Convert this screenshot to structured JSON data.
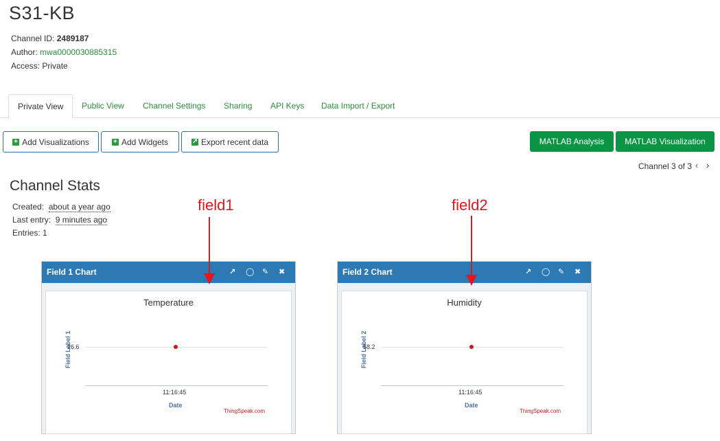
{
  "page": {
    "title": "S31-KB",
    "channel_id_label": "Channel ID:",
    "channel_id": "2489187",
    "author_label": "Author:",
    "author": "mwa0000030885315",
    "access_label": "Access:",
    "access": "Private"
  },
  "tabs": [
    {
      "label": "Private View",
      "active": true
    },
    {
      "label": "Public View"
    },
    {
      "label": "Channel Settings"
    },
    {
      "label": "Sharing"
    },
    {
      "label": "API Keys"
    },
    {
      "label": "Data Import / Export"
    }
  ],
  "toolbar": {
    "add_visualizations": "Add Visualizations",
    "add_widgets": "Add Widgets",
    "export_recent": "Export recent data",
    "matlab_analysis": "MATLAB Analysis",
    "matlab_visualization": "MATLAB Visualization",
    "channel_nav": "Channel 3 of 3",
    "prev_icon": "chevron-left-icon",
    "next_icon": "chevron-right-icon"
  },
  "stats": {
    "heading": "Channel Stats",
    "created_label": "Created:",
    "created": "about a year ago",
    "last_entry_label": "Last entry:",
    "last_entry": "9 minutes ago",
    "entries_label": "Entries:",
    "entries": "1"
  },
  "annotations": {
    "field1": "field1",
    "field2": "field2",
    "color": "#e8141b"
  },
  "charts": [
    {
      "header": "Field 1 Chart",
      "title": "Temperature",
      "ylabel": "Field Label 1",
      "ytick": "26.6",
      "xtick": "11:16:45",
      "xlabel": "Date",
      "credit": "ThingSpeak.com"
    },
    {
      "header": "Field 2 Chart",
      "title": "Humidity",
      "ylabel": "Field Label 2",
      "ytick": "58.2",
      "xtick": "11:16:45",
      "xlabel": "Date",
      "credit": "ThingSpeak.com"
    }
  ],
  "chart_data": [
    {
      "type": "line",
      "title": "Temperature",
      "xlabel": "Date",
      "ylabel": "Field Label 1",
      "x": [
        "11:16:45"
      ],
      "values": [
        26.6
      ]
    },
    {
      "type": "line",
      "title": "Humidity",
      "xlabel": "Date",
      "ylabel": "Field Label 2",
      "x": [
        "11:16:45"
      ],
      "values": [
        58.2
      ]
    }
  ],
  "colors": {
    "link": "#2d8a3f",
    "header_blue": "#2d79b3",
    "matlab_green": "#0a9444",
    "point_red": "#c41b1b"
  }
}
